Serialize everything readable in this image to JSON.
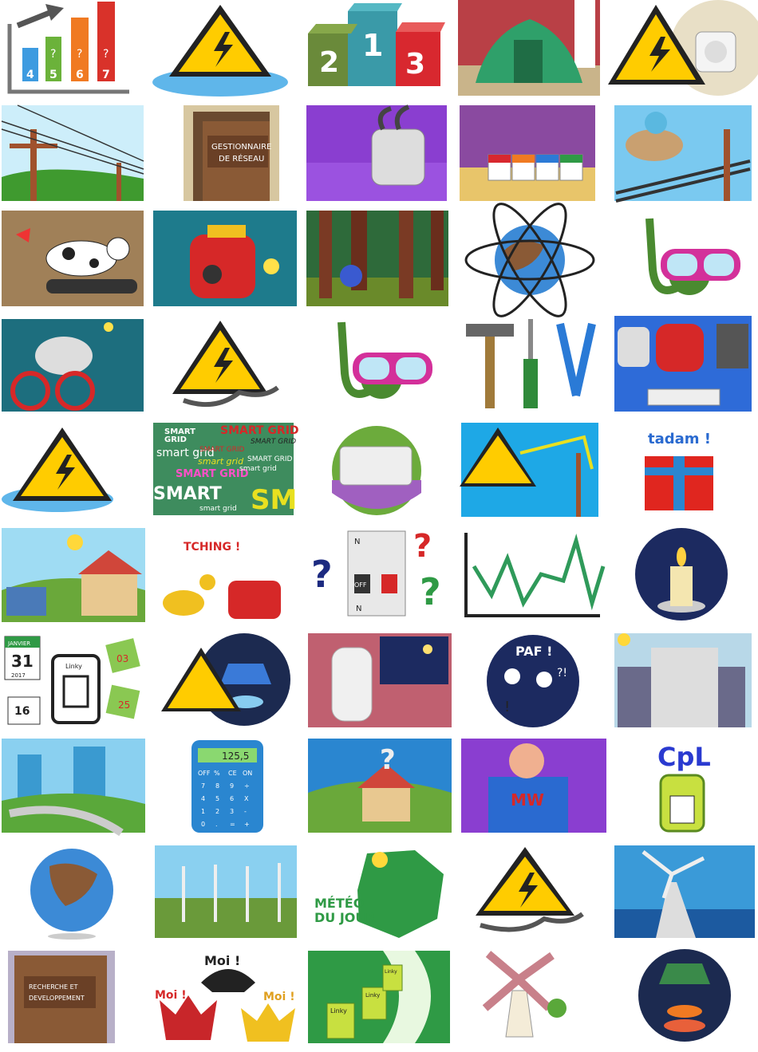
{
  "tiles": {
    "podium": [
      "2",
      "1",
      "3"
    ],
    "growth_chart": [
      "4",
      "5",
      "6",
      "7"
    ],
    "growth_marks": [
      "?",
      "?",
      "?"
    ],
    "network_manager_door": [
      "GESTIONNAIRE",
      "DE RÉSEAU"
    ],
    "smart_grid": [
      "SMART",
      "GRID",
      "SMART GRID",
      "SMART GRID",
      "smart grid",
      "smart grid",
      "SMART GRID",
      "smart grid",
      "SMART GRID",
      "SMART",
      "smart grid",
      "SM",
      "SMART GRID"
    ],
    "gift": "tadam !",
    "coins": "TCHING !",
    "breaker": [
      "N",
      "N",
      "OFF"
    ],
    "question_marks": [
      "?",
      "?",
      "?"
    ],
    "calendar": [
      "JANVIER",
      "31",
      "2017",
      "16",
      "03",
      "25"
    ],
    "linky_device": "Linky",
    "paf": "PAF !",
    "paf_marks": [
      "?!",
      "!"
    ],
    "calculator_display": "125,5",
    "calculator_keys": [
      "OFF",
      "%",
      "CE",
      "ON",
      "7",
      "8",
      "9",
      "÷",
      "4",
      "5",
      "6",
      "X",
      "1",
      "2",
      "3",
      "-",
      "0",
      ".",
      "=",
      "+"
    ],
    "superhero_chest": "MW",
    "cpl": "CpL",
    "meteo": [
      "MÉTÉO",
      "DU JOUR"
    ],
    "rd_door": [
      "RECHERCHE ET",
      "DEVELOPPEMENT"
    ],
    "moi": [
      "Moi !",
      "Moi !",
      "Moi !"
    ],
    "linky_boxes": [
      "Linky",
      "Linky",
      "Linky"
    ]
  },
  "colors": {
    "warning_yellow": "#ffcc00",
    "sky": "#9fdcf3",
    "grass": "#5aa83a",
    "purple": "#7a3cc8"
  }
}
